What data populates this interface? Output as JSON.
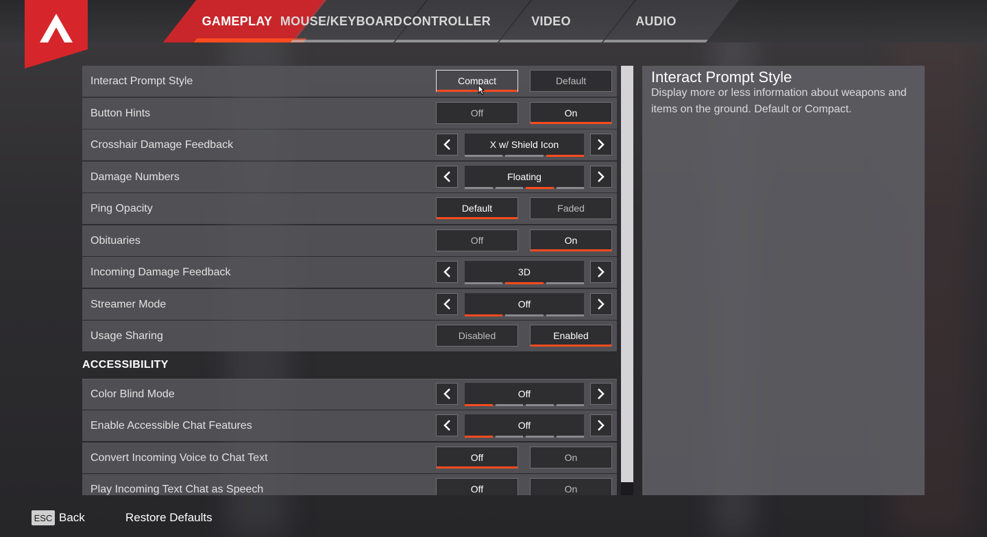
{
  "tabs": [
    {
      "label": "GAMEPLAY",
      "active": true
    },
    {
      "label": "MOUSE/KEYBOARD",
      "active": false
    },
    {
      "label": "CONTROLLER",
      "active": false
    },
    {
      "label": "VIDEO",
      "active": false
    },
    {
      "label": "AUDIO",
      "active": false
    }
  ],
  "colors": {
    "accent": "#ff4b1f",
    "brand": "#c8262b"
  },
  "settings": [
    {
      "label": "Interact Prompt Style",
      "type": "toggle",
      "options": [
        "Compact",
        "Default"
      ],
      "selected": 0
    },
    {
      "label": "Button Hints",
      "type": "toggle",
      "options": [
        "Off",
        "On"
      ],
      "selected": 1
    },
    {
      "label": "Crosshair Damage Feedback",
      "type": "stepper",
      "value": "X w/ Shield Icon",
      "pips": 3,
      "active_pip": 2
    },
    {
      "label": "Damage Numbers",
      "type": "stepper",
      "value": "Floating",
      "pips": 4,
      "active_pip": 2
    },
    {
      "label": "Ping Opacity",
      "type": "toggle",
      "options": [
        "Default",
        "Faded"
      ],
      "selected": 0
    },
    {
      "label": "Obituaries",
      "type": "toggle",
      "options": [
        "Off",
        "On"
      ],
      "selected": 1
    },
    {
      "label": "Incoming Damage Feedback",
      "type": "stepper",
      "value": "3D",
      "pips": 3,
      "active_pip": 1
    },
    {
      "label": "Streamer Mode",
      "type": "stepper",
      "value": "Off",
      "pips": 3,
      "active_pip": 0
    },
    {
      "label": "Usage Sharing",
      "type": "toggle",
      "options": [
        "Disabled",
        "Enabled"
      ],
      "selected": 1
    }
  ],
  "accessibility": {
    "header": "ACCESSIBILITY",
    "settings": [
      {
        "label": "Color Blind Mode",
        "type": "stepper",
        "value": "Off",
        "pips": 4,
        "active_pip": 0
      },
      {
        "label": "Enable Accessible Chat Features",
        "type": "stepper",
        "value": "Off",
        "pips": 4,
        "active_pip": 0
      },
      {
        "label": "Convert Incoming Voice to Chat Text",
        "type": "toggle",
        "options": [
          "Off",
          "On"
        ],
        "selected": 0
      },
      {
        "label": "Play Incoming Text Chat as Speech",
        "type": "toggle",
        "options": [
          "Off",
          "On"
        ],
        "selected": 0
      }
    ]
  },
  "description": {
    "title": "Interact Prompt Style",
    "body": "Display more or less information about weapons and items on the ground.  Default or Compact."
  },
  "footer": {
    "esc_key": "ESC",
    "back_label": "Back",
    "restore_label": "Restore Defaults"
  },
  "icons": {
    "logo": "apex-logo-icon",
    "left": "chevron-left-icon",
    "right": "chevron-right-icon",
    "cursor": "mouse-cursor-icon"
  }
}
